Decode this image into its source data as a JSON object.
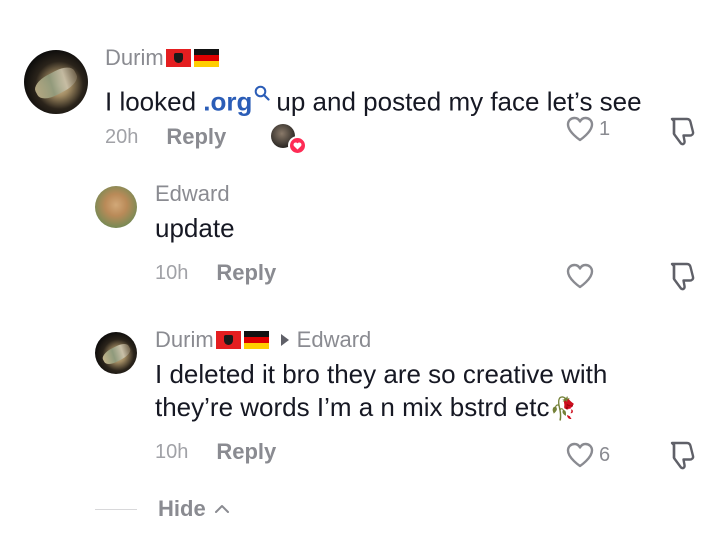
{
  "comments": [
    {
      "username": "Durim",
      "flags": [
        "albania-flag",
        "germany-flag"
      ],
      "text_before": "I looked ",
      "link": ".org",
      "text_after": "up and posted my face let’s see",
      "time": "20h",
      "reply_label": "Reply",
      "likes": "1"
    },
    {
      "username": "Edward",
      "text": "update",
      "time": "10h",
      "reply_label": "Reply"
    },
    {
      "username": "Durim",
      "flags": [
        "albania-flag",
        "germany-flag"
      ],
      "reply_to": "Edward",
      "text_line1": "I deleted it bro they are so creative with",
      "text_line2": "they’re words I’m a n mix bstrd etc",
      "emoji": "🥀",
      "time": "10h",
      "reply_label": "Reply",
      "likes": "6"
    }
  ],
  "hide_label": "Hide",
  "colors": {
    "link": "#2b5db7",
    "muted": "#8a8b91",
    "heart": "#fe2c55"
  }
}
